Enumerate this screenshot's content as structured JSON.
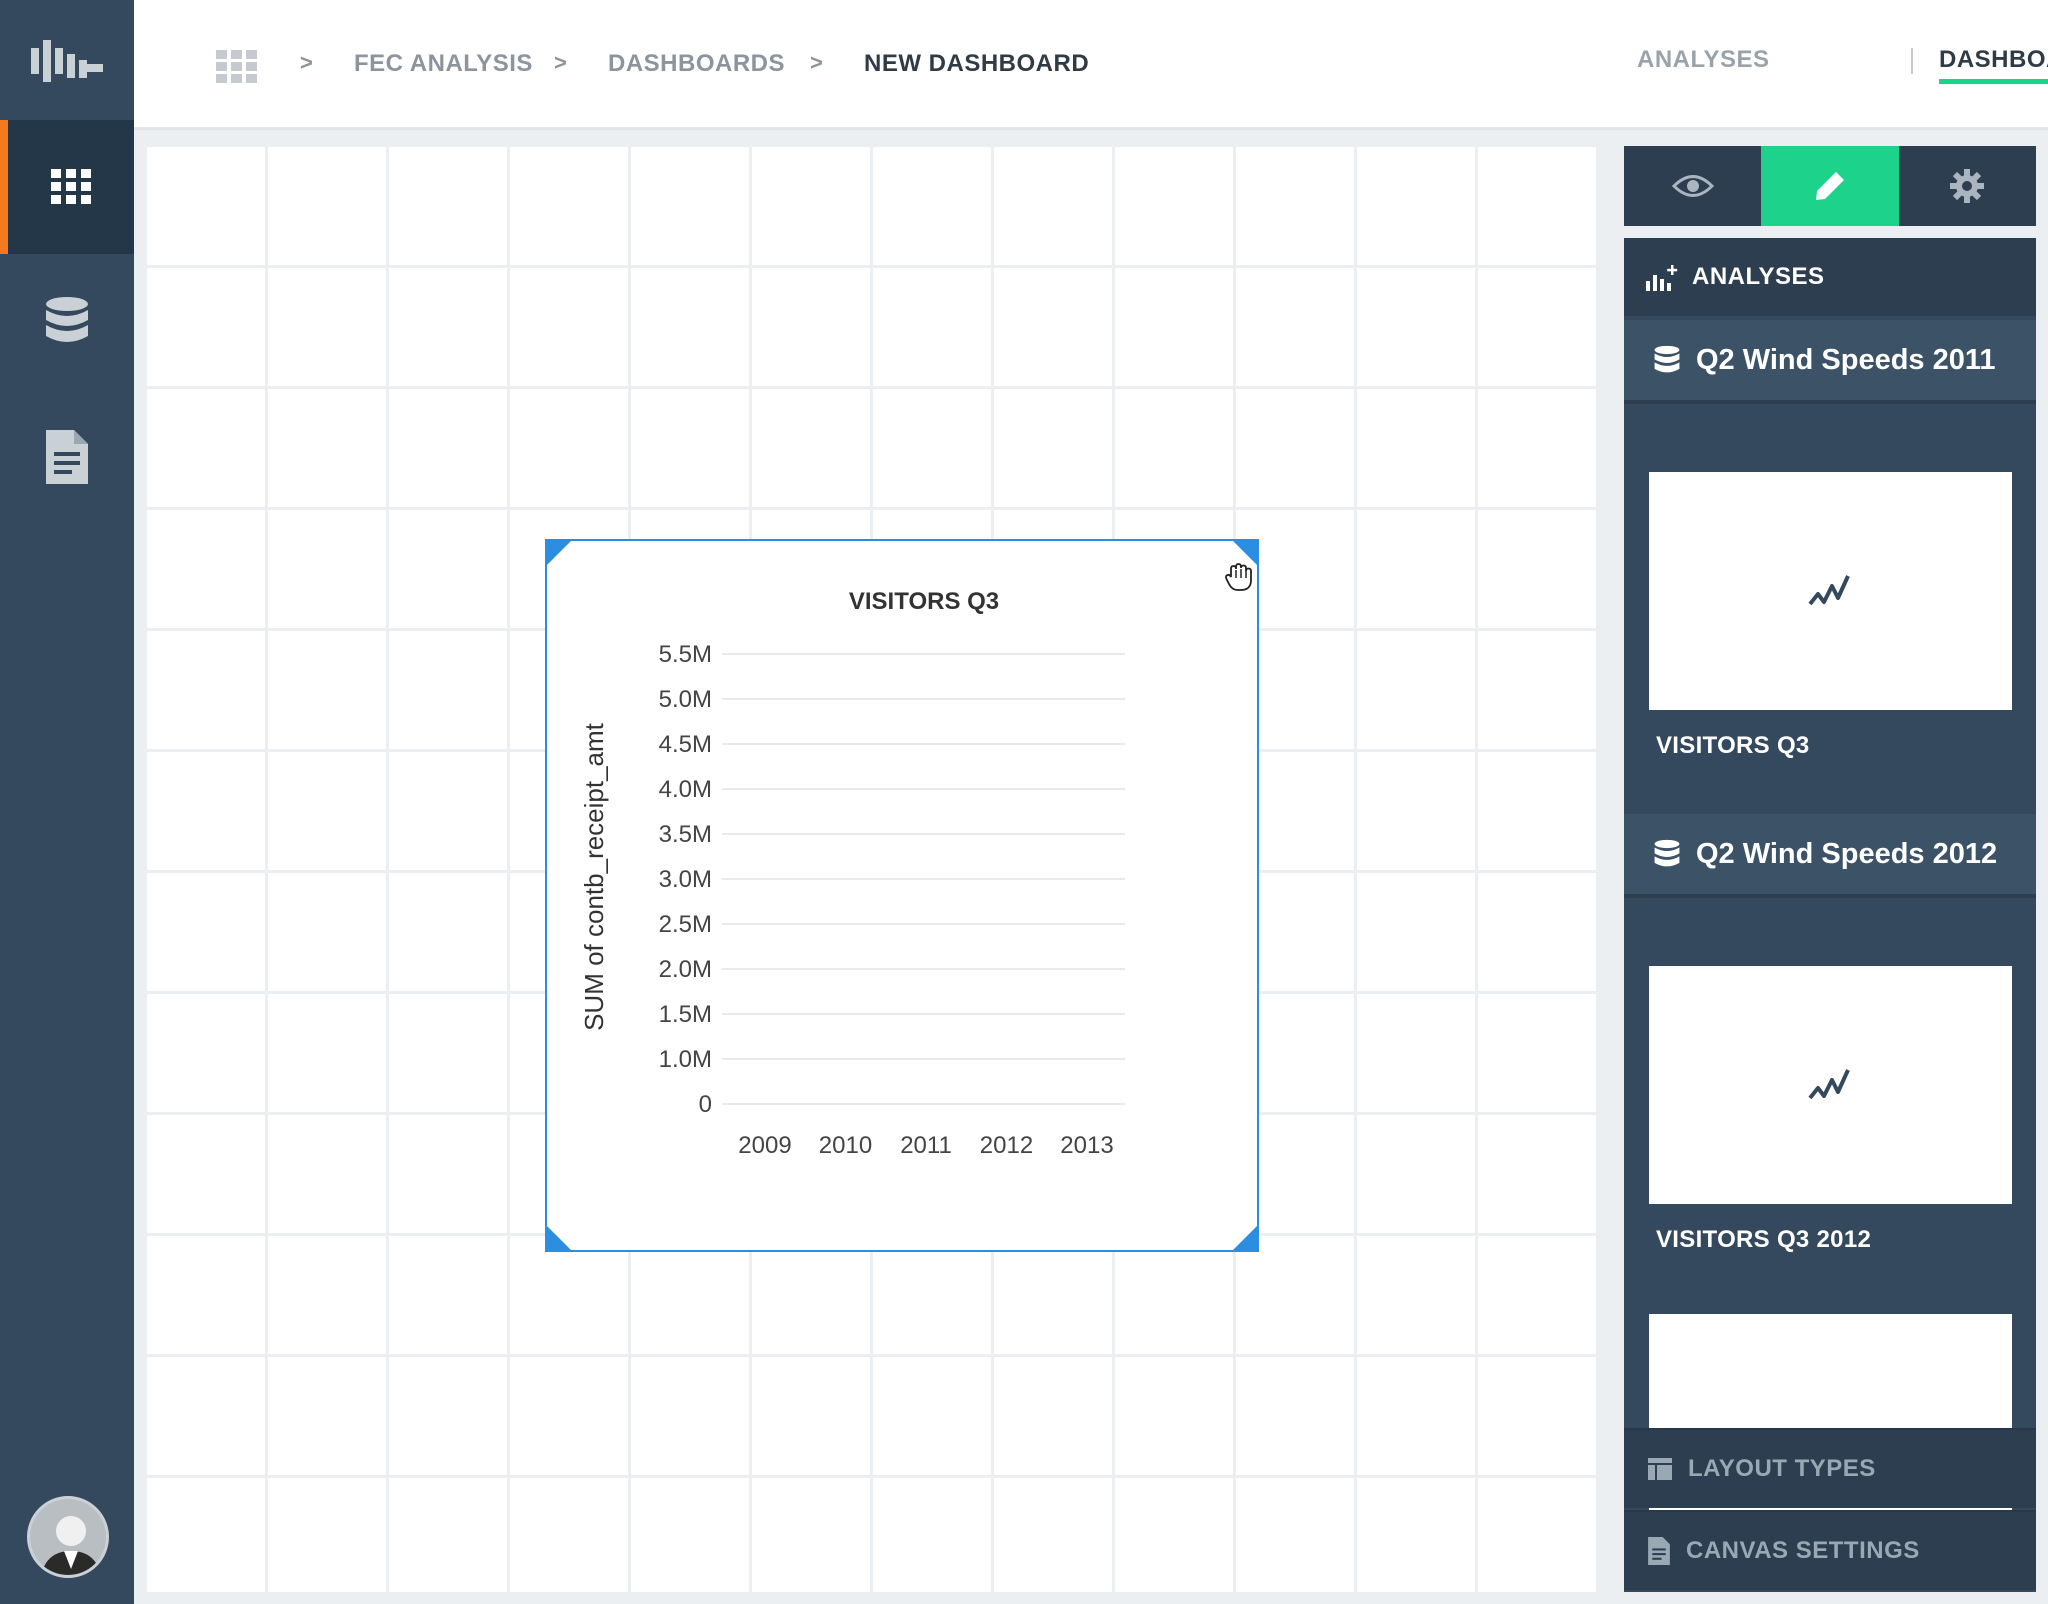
{
  "breadcrumb": {
    "items": [
      "FEC ANALYSIS",
      "DASHBOARDS",
      "NEW DASHBOARD"
    ],
    "separator": ">"
  },
  "top_tabs": {
    "analyses": "ANALYSES",
    "dashboards": "DASHBOARDS"
  },
  "colors": {
    "accent": "#1dd28b",
    "sidebar": "#34495e",
    "active_marker": "#f47a20",
    "selection": "#2b8ee0"
  },
  "sidebar": {
    "icons": [
      "logo-icon",
      "dashboard-grid-icon",
      "database-icon",
      "document-icon"
    ],
    "active": "dashboard-grid-icon"
  },
  "right_panel": {
    "modes": [
      "eye-icon",
      "pencil-icon",
      "gear-icon"
    ],
    "active_mode": "pencil-icon",
    "section_title": "ANALYSES",
    "datasets": [
      {
        "name": "Q2 Wind Speeds 2011",
        "analysis": "VISITORS Q3"
      },
      {
        "name": "Q2 Wind Speeds 2012",
        "analysis": "VISITORS Q3 2012"
      }
    ],
    "layout_types": "LAYOUT TYPES",
    "canvas_settings": "CANVAS SETTINGS"
  },
  "chart_data": {
    "type": "line",
    "title": "VISITORS Q3",
    "xlabel": "",
    "ylabel": "SUM of contb_receipt_amt",
    "x": [
      "2009",
      "2010",
      "2011",
      "2012",
      "2013"
    ],
    "y_ticks": [
      "0",
      "1.0M",
      "1.5M",
      "2.0M",
      "2.5M",
      "3.0M",
      "3.5M",
      "4.0M",
      "4.5M",
      "5.0M",
      "5.5M"
    ],
    "series": [],
    "grid": true
  }
}
